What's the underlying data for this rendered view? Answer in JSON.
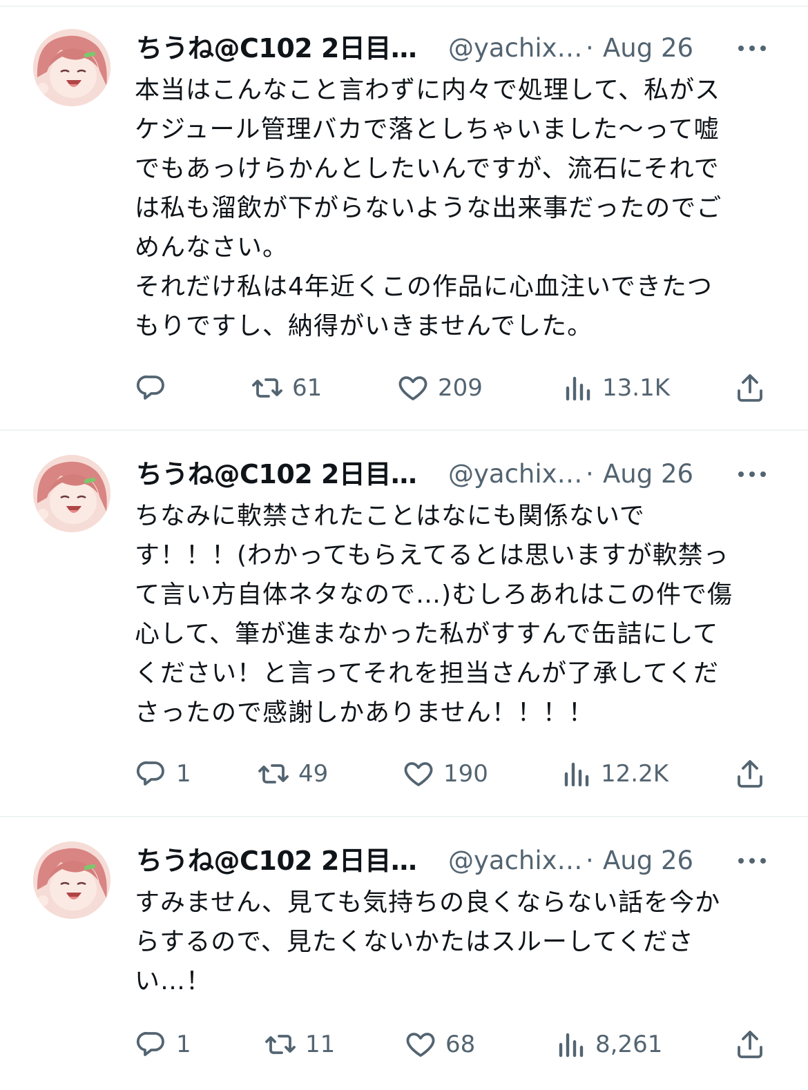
{
  "colors": {
    "text_primary": "#0f1419",
    "text_secondary": "#536471",
    "divider": "#eff3f4",
    "background": "#ffffff"
  },
  "tweets": [
    {
      "display_name": "ちうね@C102 2日目…",
      "handle": "@yachix…",
      "separator": "·",
      "date": "Aug 26",
      "text": "本当はこんなこと言わずに内々で処理して、私がス\nケジュール管理バカで落としちゃいました〜って嘘\nでもあっけらかんとしたいんですが、流石にそれで\nは私も溜飲が下がらないような出来事だったのでご\nめんなさい。\nそれだけ私は4年近くこの作品に心血注いできたつ\nもりですし、納得がいきませんでした。",
      "replies": "",
      "retweets": "61",
      "likes": "209",
      "views": "13.1K"
    },
    {
      "display_name": "ちうね@C102 2日目…",
      "handle": "@yachix…",
      "separator": "·",
      "date": "Aug 26",
      "text": "ちなみに軟禁されたことはなにも関係ないで\nす！！！(わかってもらえてるとは思いますが軟禁っ\nて言い方自体ネタなので…)むしろあれはこの件で傷\n心して、筆が進まなかった私がすすんで缶詰にして\nください！と言ってそれを担当さんが了承してくだ\nさったので感謝しかありません！！！！",
      "replies": "1",
      "retweets": "49",
      "likes": "190",
      "views": "12.2K"
    },
    {
      "display_name": "ちうね@C102 2日目…",
      "handle": "@yachix…",
      "separator": "·",
      "date": "Aug 26",
      "text": "すみません、見ても気持ちの良くならない話を今か\nらするので、見たくないかたはスルーしてくださ\nい…！",
      "replies": "1",
      "retweets": "11",
      "likes": "68",
      "views": "8,261"
    }
  ]
}
